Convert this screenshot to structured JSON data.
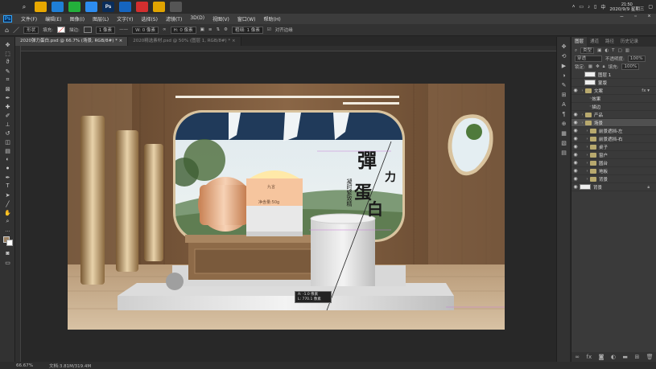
{
  "taskbar": {
    "apps": [
      {
        "name": "windows-icon",
        "label": "",
        "color": "#2b2b2b"
      },
      {
        "name": "search-icon",
        "label": "⌕",
        "color": "#2b2b2b"
      },
      {
        "name": "file-explorer-icon",
        "label": "",
        "color": "#e8a800"
      },
      {
        "name": "store-icon",
        "label": "",
        "color": "#1f7fd6"
      },
      {
        "name": "wechat-icon",
        "label": "",
        "color": "#23b03b"
      },
      {
        "name": "browser-icon",
        "label": "",
        "color": "#2d8cf0"
      },
      {
        "name": "photoshop-icon",
        "label": "Ps",
        "color": "#0a2d5a"
      },
      {
        "name": "app-blue-icon",
        "label": "",
        "color": "#1565c0"
      },
      {
        "name": "app-red-icon",
        "label": "",
        "color": "#d32f2f"
      },
      {
        "name": "chrome-icon",
        "label": "",
        "color": "#e0a400"
      },
      {
        "name": "app-clock-icon",
        "label": "",
        "color": "#555555"
      }
    ],
    "clock_time": "21:50",
    "clock_date": "2020/9/9 星期三"
  },
  "menubar": {
    "logo": "Ps",
    "items": [
      "文件(F)",
      "编辑(E)",
      "图像(I)",
      "图层(L)",
      "文字(Y)",
      "选择(S)",
      "滤镜(T)",
      "3D(D)",
      "视图(V)",
      "窗口(W)",
      "帮助(H)"
    ]
  },
  "optbar": {
    "shape": "形状",
    "fill_label": "填充:",
    "stroke_label": "描边:",
    "stroke_width": "1 像素",
    "w_label": "W: 0 像素",
    "h_label": "H: 0 像素",
    "radius_label": "粗细: 1 像素",
    "align_edges": "对齐边缘"
  },
  "tabs": [
    {
      "label": "2020弹力蛋白.psd @ 66.7% (场景, RGB/8#) *",
      "active": true
    },
    {
      "label": "2020精选素材.psd @ 50% (图层 1, RGB/8#) *",
      "active": false
    }
  ],
  "artboard": {
    "title_1": "彈",
    "title_2": "力",
    "title_3": "蛋",
    "title_4": "白",
    "subtitle": "凝时緊致精",
    "jar_brand": "九言",
    "jar_net": "净含量:50g",
    "measure_1": "A: -1.0 像素",
    "measure_2": "L: 770.1 像素"
  },
  "layers_panel": {
    "tabs": [
      "图层",
      "通道",
      "路径",
      "历史记录"
    ],
    "kind": "类型",
    "blend": "穿透",
    "opacity_label": "不透明度:",
    "opacity": "100%",
    "lock_label": "锁定:",
    "fill_label": "填充:",
    "fill": "100%",
    "layers": [
      {
        "label": "图层 1",
        "indent": 1,
        "type": "pixel",
        "eye": false,
        "fx": false
      },
      {
        "label": "蒙版",
        "indent": 1,
        "type": "pixel",
        "eye": false,
        "fx": false
      },
      {
        "label": "文案",
        "indent": 0,
        "type": "folder",
        "eye": true,
        "fx": true
      },
      {
        "label": "效果",
        "indent": 2,
        "type": "text",
        "eye": false,
        "fx": false
      },
      {
        "label": "描边",
        "indent": 2,
        "type": "text",
        "eye": false,
        "fx": false
      },
      {
        "label": "产品",
        "indent": 0,
        "type": "folder",
        "eye": true,
        "fx": false
      },
      {
        "label": "场景",
        "indent": 0,
        "type": "folder",
        "eye": true,
        "fx": false,
        "selected": true
      },
      {
        "label": "前景遮挡-左",
        "indent": 1,
        "type": "folder",
        "eye": true,
        "fx": false
      },
      {
        "label": "前景遮挡-右",
        "indent": 1,
        "type": "folder",
        "eye": true,
        "fx": false
      },
      {
        "label": "桌子",
        "indent": 1,
        "type": "folder",
        "eye": true,
        "fx": false
      },
      {
        "label": "窗户",
        "indent": 1,
        "type": "folder",
        "eye": true,
        "fx": false
      },
      {
        "label": "圆台",
        "indent": 1,
        "type": "folder",
        "eye": true,
        "fx": false
      },
      {
        "label": "地板",
        "indent": 1,
        "type": "folder",
        "eye": true,
        "fx": false
      },
      {
        "label": "背景",
        "indent": 1,
        "type": "folder",
        "eye": true,
        "fx": false
      },
      {
        "label": "背景",
        "indent": 0,
        "type": "pixel",
        "eye": true,
        "fx": false,
        "lock": true
      }
    ]
  },
  "status": {
    "zoom": "66.67%",
    "doc": "文档:3.81M/319.4M"
  }
}
